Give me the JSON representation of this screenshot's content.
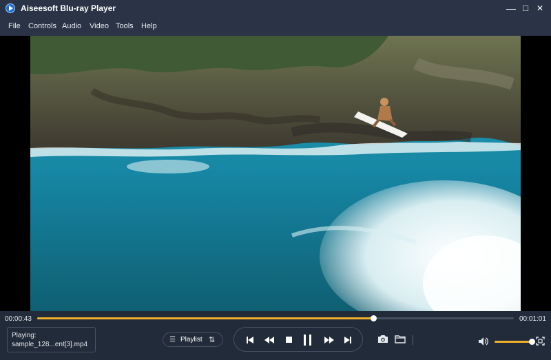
{
  "window": {
    "title": "Aiseesoft Blu-ray Player",
    "minimize": "—",
    "maximize": "□",
    "close": "✕"
  },
  "menu": [
    "File",
    "Controls",
    "Audio",
    "Video",
    "Tools",
    "Help"
  ],
  "playback": {
    "current_time": "00:00:43",
    "total_time": "00:01:01",
    "progress": 0.705,
    "volume": 1.0
  },
  "now_playing": {
    "label": "Playing:",
    "filename": "sample_128...ent[3].mp4"
  },
  "playlist": {
    "label": "Playlist",
    "left_icon": "list-icon",
    "right_icon": "sort-order-icon"
  },
  "icons": {
    "app": "player-logo-icon",
    "prev": "skip-previous-icon",
    "rewind": "rewind-icon",
    "stop": "stop-icon",
    "pause": "pause-icon",
    "forward": "fast-forward-icon",
    "next": "skip-next-icon",
    "snapshot": "camera-icon",
    "open": "folder-icon",
    "volume": "speaker-icon",
    "fullscreen": "fullscreen-icon"
  },
  "colors": {
    "accent": "#f2b12a",
    "chrome": "#2a3446",
    "controls_bg": "#222b39"
  }
}
